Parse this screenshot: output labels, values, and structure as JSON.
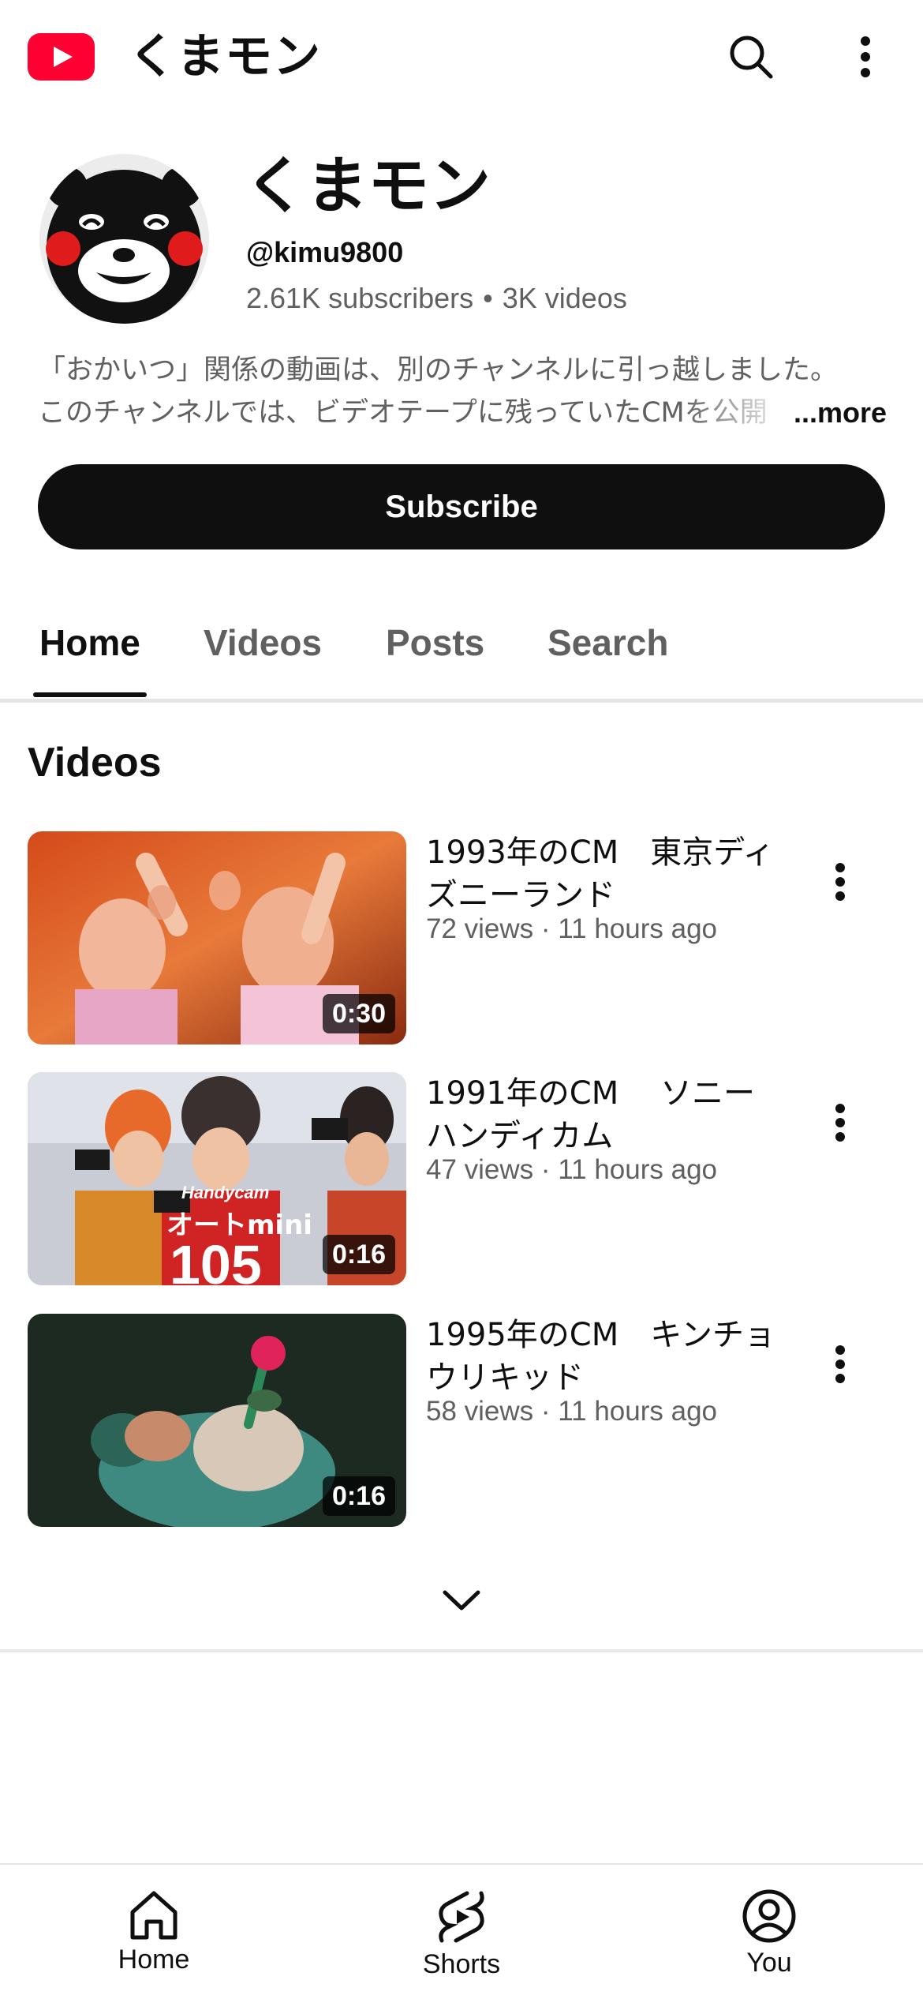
{
  "app": {
    "title": "くまモン"
  },
  "header": {
    "search_icon": "search-icon",
    "more_icon": "more-vert-icon"
  },
  "channel": {
    "name": "くまモン",
    "handle": "@kimu9800",
    "subscribers": "2.61K subscribers",
    "separator": "•",
    "videos_count": "3K videos",
    "description_line1": "「おかいつ」関係の動画は、別のチャンネルに引っ越しました。",
    "description_line2": "このチャンネルでは、ビデオテープに残っていたCMを公開",
    "more_label": "...more",
    "subscribe_label": "Subscribe"
  },
  "tabs": [
    {
      "label": "Home",
      "active": true
    },
    {
      "label": "Videos",
      "active": false
    },
    {
      "label": "Posts",
      "active": false
    },
    {
      "label": "Search",
      "active": false
    }
  ],
  "videos_section": {
    "title": "Videos",
    "items": [
      {
        "title": "1993年のCM　東京ディズニーランド",
        "meta": "72 views · 11 hours ago",
        "duration": "0:30"
      },
      {
        "title": "1991年のCM　 ソニー ハンディカム",
        "meta": "47 views · 11 hours ago",
        "duration": "0:16"
      },
      {
        "title": "1995年のCM　キンチョウリキッド",
        "meta": "58 views · 11 hours ago",
        "duration": "0:16"
      }
    ],
    "expand_icon": "chevron-down-icon"
  },
  "bottom_nav": [
    {
      "label": "Home",
      "icon": "home-icon"
    },
    {
      "label": "Shorts",
      "icon": "shorts-icon"
    },
    {
      "label": "You",
      "icon": "account-icon"
    }
  ],
  "colors": {
    "brand": "#ff0033",
    "text": "#0f0f0f",
    "secondary": "#606060"
  }
}
